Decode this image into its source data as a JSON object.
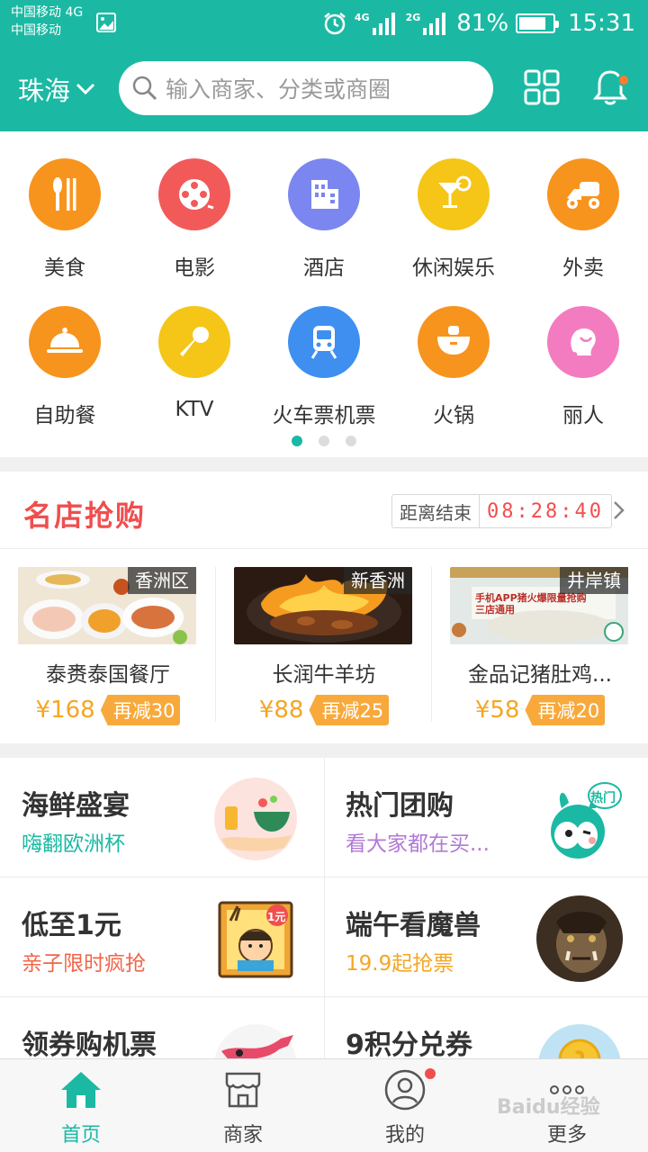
{
  "status_bar": {
    "carrier_line1": "中国移动 4G",
    "carrier_line2": "中国移动",
    "net1": "4G",
    "net2": "2G",
    "battery": "81%",
    "battery_level": 0.81,
    "time": "15:31"
  },
  "header": {
    "city": "珠海",
    "search_placeholder": "输入商家、分类或商圈",
    "notification_dot": true,
    "accent": "#1bb9a3"
  },
  "categories": [
    {
      "label": "美食",
      "color": "#f7941d",
      "icon": "fork-knife-icon"
    },
    {
      "label": "电影",
      "color": "#f25a5a",
      "icon": "film-reel-icon"
    },
    {
      "label": "酒店",
      "color": "#7b86f0",
      "icon": "building-icon"
    },
    {
      "label": "休闲娱乐",
      "color": "#f5c518",
      "icon": "cocktail-icon"
    },
    {
      "label": "外卖",
      "color": "#f7941d",
      "icon": "delivery-scooter-icon"
    },
    {
      "label": "自助餐",
      "color": "#f7941d",
      "icon": "food-cloche-icon"
    },
    {
      "label": "KTV",
      "color": "#f5c518",
      "icon": "microphone-icon"
    },
    {
      "label": "火车票机票",
      "color": "#3f8ff0",
      "icon": "train-icon"
    },
    {
      "label": "火锅",
      "color": "#f7941d",
      "icon": "hotpot-icon"
    },
    {
      "label": "丽人",
      "color": "#f37cc0",
      "icon": "woman-profile-icon"
    }
  ],
  "pager": {
    "count": 3,
    "active": 0
  },
  "flash_sale": {
    "title": "名店抢购",
    "timer_label": "距离结束",
    "timer_value": "08:28:40",
    "title_color": "#f04e4e",
    "shops": [
      {
        "area": "香洲区",
        "name": "泰赉泰国餐厅",
        "price": "¥168",
        "discount": "再减30"
      },
      {
        "area": "新香洲",
        "name": "长润牛羊坊",
        "price": "¥88",
        "discount": "再减25"
      },
      {
        "area": "井岸镇",
        "name": "金品记猪肚鸡...",
        "price": "¥58",
        "discount": "再减20",
        "image_text": "手机APP猪火爆限量抢购\n三店通用"
      }
    ]
  },
  "promos": [
    {
      "title": "海鲜盛宴",
      "subtitle": "嗨翻欧洲杯",
      "sub_color": "#1bb9a3"
    },
    {
      "title": "热门团购",
      "subtitle": "看大家都在买...",
      "sub_color": "#b07ad6",
      "art_text": "热门"
    },
    {
      "title": "低至1元",
      "subtitle": "亲子限时疯抢",
      "sub_color": "#f0664a",
      "art_text": "1元"
    },
    {
      "title": "端午看魔兽",
      "subtitle": "19.9起抢票",
      "sub_color": "#f5a623"
    },
    {
      "title": "领券购机票",
      "subtitle": "",
      "sub_color": "#1bb9a3"
    },
    {
      "title": "9积分兑券",
      "subtitle": "",
      "sub_color": "#1bb9a3"
    }
  ],
  "tabbar": {
    "tabs": [
      {
        "label": "首页",
        "icon": "home-icon",
        "active": true
      },
      {
        "label": "商家",
        "icon": "store-icon",
        "active": false
      },
      {
        "label": "我的",
        "icon": "user-icon",
        "active": false,
        "dot": true
      },
      {
        "label": "更多",
        "icon": "more-dots-icon",
        "active": false
      }
    ]
  },
  "watermark": "Baidu经验"
}
